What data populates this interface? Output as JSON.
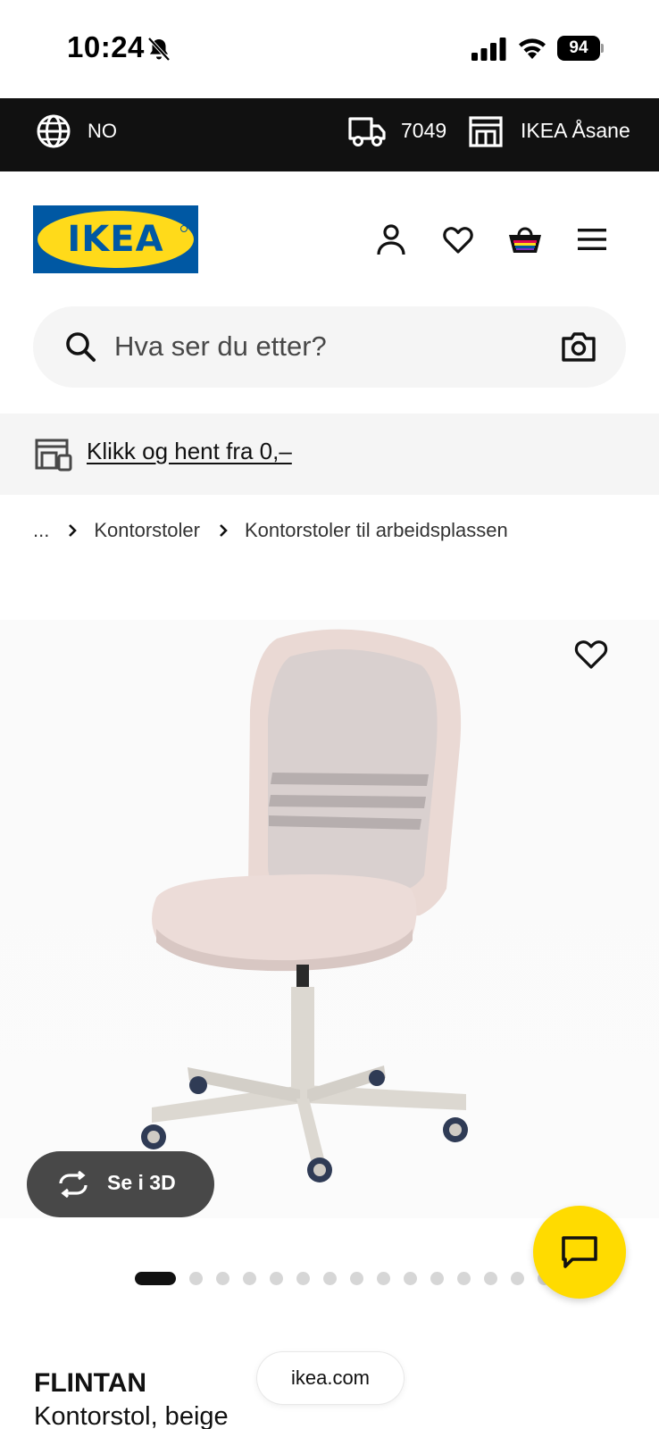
{
  "status_bar": {
    "time": "10:24",
    "battery": "94"
  },
  "top_bar": {
    "language": "NO",
    "postal_code": "7049",
    "store": "IKEA Åsane"
  },
  "header": {
    "logo_text": "IKEA",
    "icons": [
      "user-icon",
      "heart-icon",
      "shopping-bag-icon",
      "menu-icon"
    ]
  },
  "search": {
    "placeholder": "Hva ser du etter?"
  },
  "promo": {
    "link_text": "Klikk og hent fra 0,–"
  },
  "breadcrumb": {
    "items": [
      "...",
      "Kontorstoler",
      "Kontorstoler til arbeidsplassen"
    ]
  },
  "gallery": {
    "view_3d_label": "Se i 3D",
    "image_count": 15,
    "active_index": 0
  },
  "product": {
    "name": "FLINTAN",
    "description": "Kontorstol, beige"
  },
  "browser": {
    "domain": "ikea.com"
  },
  "colors": {
    "ikea_blue": "#0058a3",
    "ikea_yellow": "#ffda1a",
    "chat_yellow": "#ffdb00",
    "top_bar_bg": "#111111",
    "pill_bg": "#484848"
  }
}
